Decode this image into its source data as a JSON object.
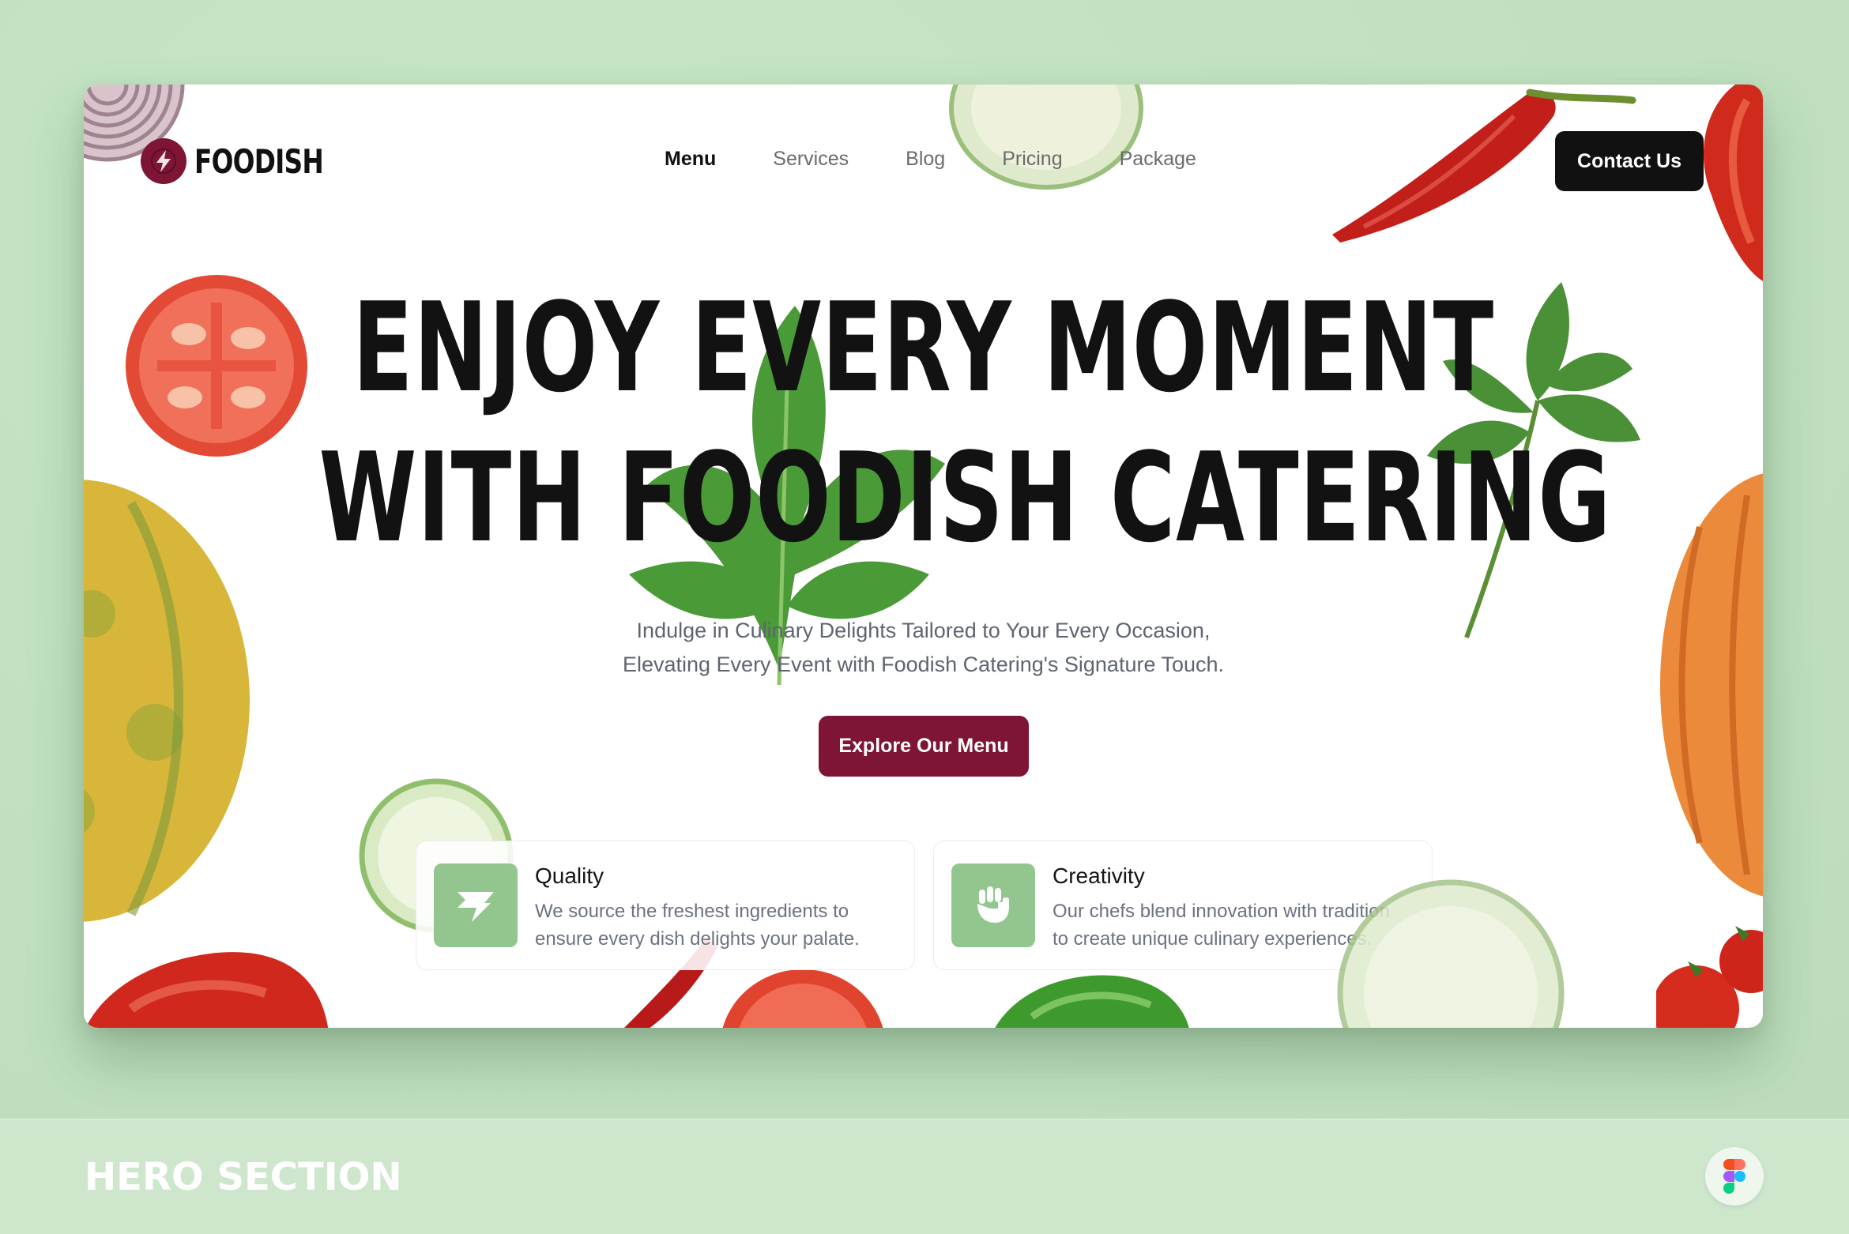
{
  "brand": {
    "name": "FOODISH"
  },
  "nav": {
    "items": [
      {
        "label": "Menu",
        "active": true
      },
      {
        "label": "Services",
        "active": false
      },
      {
        "label": "Blog",
        "active": false
      },
      {
        "label": "Pricing",
        "active": false
      },
      {
        "label": "Package",
        "active": false
      }
    ],
    "contact_label": "Contact Us"
  },
  "hero": {
    "title_line1": "ENJOY EVERY MOMENT",
    "title_line2": "WITH FOODISH CATERING",
    "subtitle_line1": "Indulge in Culinary Delights Tailored to Your Every Occasion,",
    "subtitle_line2": "Elevating Every Event with Foodish Catering's Signature Touch.",
    "cta_label": "Explore Our Menu"
  },
  "features": [
    {
      "title": "Quality",
      "desc_line1": "We source the freshest ingredients to",
      "desc_line2": "ensure every dish delights your palate.",
      "icon": "flag-icon"
    },
    {
      "title": "Creativity",
      "desc_line1": "Our chefs blend innovation with tradition",
      "desc_line2": "to create unique culinary experiences.",
      "icon": "fist-icon"
    }
  ],
  "footer": {
    "section_label": "HERO SECTION",
    "badge_icon": "figma-icon"
  },
  "colors": {
    "background": "#c2e2c2",
    "accent": "#7e1535",
    "dark": "#111111",
    "feature_icon_bg": "#93c68f"
  }
}
